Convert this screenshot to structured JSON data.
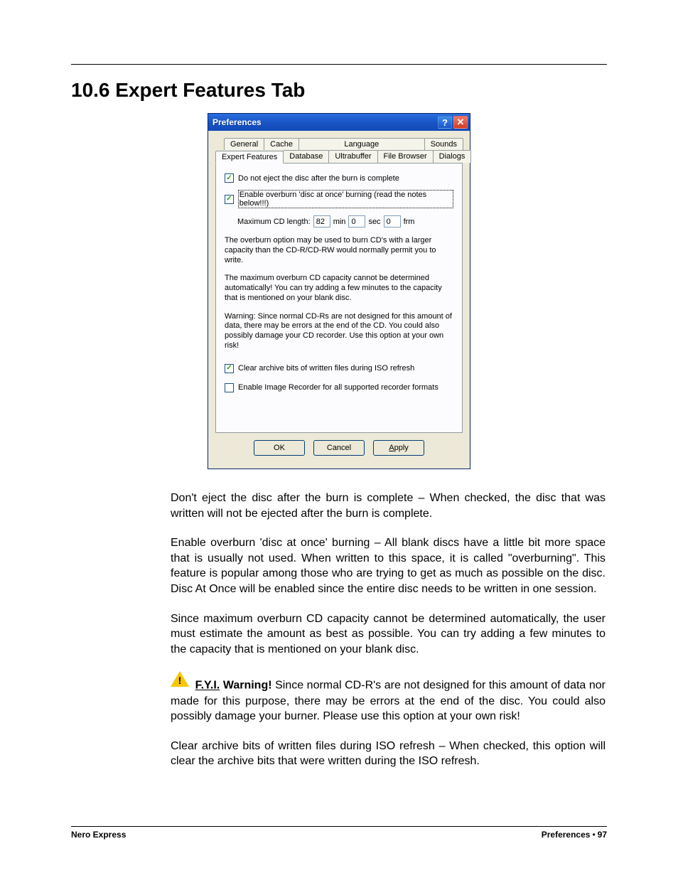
{
  "heading": "10.6  Expert Features Tab",
  "dialog": {
    "title": "Preferences",
    "tabs_row1": [
      "General",
      "Cache",
      "Language",
      "Sounds"
    ],
    "tabs_row2": [
      "Expert Features",
      "Database",
      "Ultrabuffer",
      "File Browser",
      "Dialogs"
    ],
    "active_tab": "Expert Features",
    "chk_no_eject": {
      "checked": true,
      "label": "Do not eject the disc after the burn is complete"
    },
    "chk_overburn": {
      "checked": true,
      "label": "Enable overburn 'disc at once' burning (read the notes below!!!)"
    },
    "maxlen": {
      "label": "Maximum CD length:",
      "min": "82",
      "min_unit": "min",
      "sec": "0",
      "sec_unit": "sec",
      "frm": "0",
      "frm_unit": "frm"
    },
    "note1": "The overburn option may be used to burn CD's with a larger capacity than the CD-R/CD-RW would normally permit you to write.",
    "note2": "The maximum overburn CD capacity cannot be determined automatically! You can try adding a few minutes to the capacity that is mentioned on your blank disc.",
    "note3": "Warning: Since normal CD-Rs are not designed for this amount of data, there may be errors at the end of the CD. You could also possibly damage your CD recorder. Use this option at your own risk!",
    "chk_archive": {
      "checked": true,
      "label": "Clear archive bits of written files during ISO refresh"
    },
    "chk_imagerec": {
      "checked": false,
      "label": "Enable Image Recorder for all supported recorder formats"
    },
    "buttons": {
      "ok": "OK",
      "cancel": "Cancel",
      "apply": "Apply"
    }
  },
  "paragraphs": {
    "p1": "Don't eject the disc after the burn is complete – When checked, the disc that was written will not be ejected after the burn is complete.",
    "p2": "Enable overburn 'disc at once' burning – All blank discs have a little bit more space that is usually not used. When written to this space, it is called \"overburning\". This feature is popular among those who are trying to get as much as possible on the disc. Disc At Once will be enabled since the entire disc needs to be written in one session.",
    "p3": "Since maximum overburn CD capacity cannot be determined automatically, the user must estimate the amount as best as possible. You can try adding a few minutes to the capacity that is mentioned on your blank disc.",
    "warn_label": "F.Y.I.",
    "warn_bold": "Warning!",
    "warn_text": " Since normal CD-R's are not designed for this amount of data nor made for this purpose, there may be errors at the end of the disc. You could also possibly damage your burner. Please use this option at your own risk!",
    "p5": "Clear archive bits of written files during ISO refresh – When checked, this option will clear the archive bits that were written during the ISO refresh."
  },
  "footer": {
    "left": "Nero Express",
    "right_label": "Preferences",
    "right_page": "97"
  }
}
